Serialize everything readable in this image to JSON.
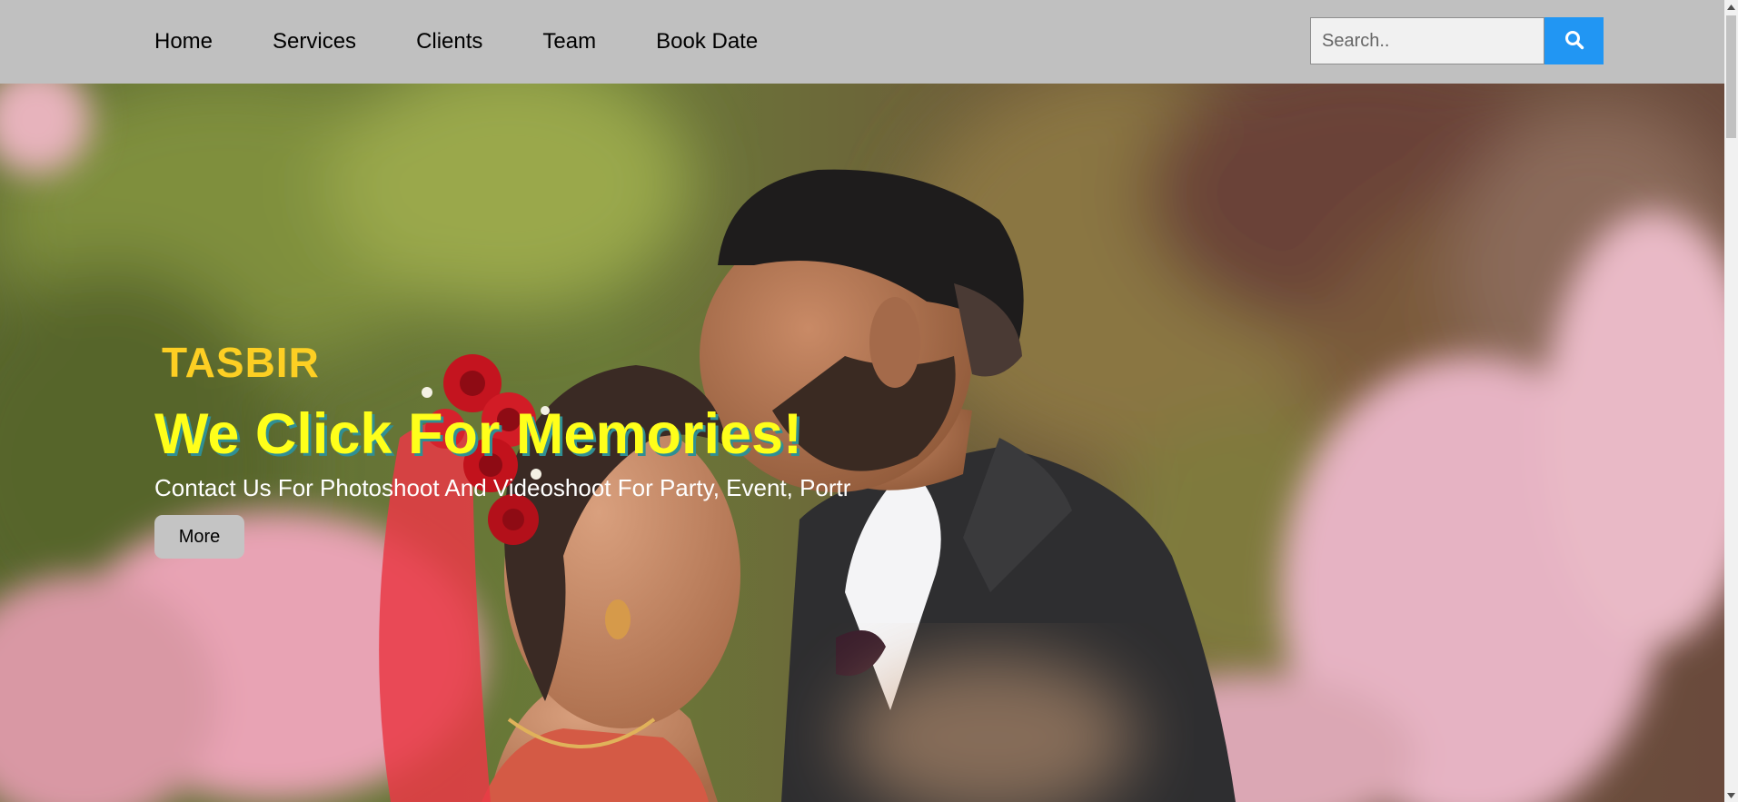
{
  "nav": {
    "items": [
      {
        "label": "Home"
      },
      {
        "label": "Services"
      },
      {
        "label": "Clients"
      },
      {
        "label": "Team"
      },
      {
        "label": "Book Date"
      }
    ]
  },
  "search": {
    "placeholder": "Search..",
    "button_icon": "search-icon"
  },
  "hero": {
    "brand": "TASBIR",
    "headline": "We Click For Memories!",
    "subtitle": "Contact Us For Photoshoot And Videoshoot For Party, Event, Portr",
    "button_label": "More",
    "image": "couple-wedding-photo"
  },
  "colors": {
    "navbar_bg": "#c0c0c0",
    "search_button": "#2196f3",
    "brand_text": "#fdcf23",
    "headline_text": "#ffff1a",
    "headline_shadow": "#2f8f94",
    "more_button": "#c4c4c4"
  }
}
